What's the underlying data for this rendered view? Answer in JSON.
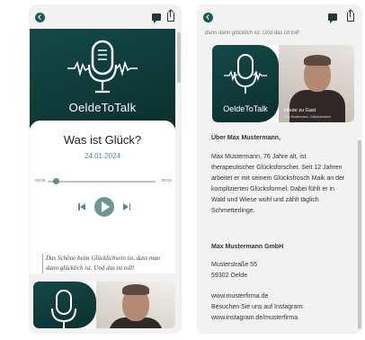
{
  "podcast": {
    "brand": "OeldeToTalk"
  },
  "episode": {
    "title": "Was ist Glück?",
    "date": "24.01.2024",
    "time_start": "00:00",
    "time_end": "00:00",
    "progress": 0.05,
    "quote": "Das Schöne beim Glücklichsein ist, dass man dann glücklich ist. Und das ist toll!"
  },
  "detail": {
    "top_fragment": "dann dann glücklich ist. Und das ist toll!",
    "guest_overlay": "Heute zu Gast",
    "guest_overlay_sub": "Max Mustermann, Glücksforscher",
    "about_heading": "Über Max Mustermann,",
    "about_text": [
      "Max Mustermann, 76 Jahre alt, ist",
      "therapeutischer Glücksforscher. Seit 12 Jahren",
      "arbeitet er mit seinem Glücksfrosch Maik an der",
      "komplizierten Glücksformel. Dabei fühlt er in",
      "Wald und Wiese wohl und zählt täglich",
      "Schmetterlinge."
    ],
    "company_name": "Max Mustermann GmbH",
    "street": "Musterstraße 55",
    "city": "59302 Oelde",
    "website": "www.musterfirma.de",
    "instagram_label": "Besuchen Sie uns auf Instagram:",
    "instagram_url": "www.instagram.de/musterfirma"
  },
  "icons": {
    "back": "back-arrow-icon",
    "chat": "chat-icon",
    "share": "share-icon",
    "mic": "microphone-icon",
    "prev": "skip-previous-icon",
    "play": "play-icon",
    "next": "skip-next-icon"
  },
  "colors": {
    "primary": "#1b5b56",
    "accent": "#4c8f8a",
    "control": "#6a9995"
  }
}
